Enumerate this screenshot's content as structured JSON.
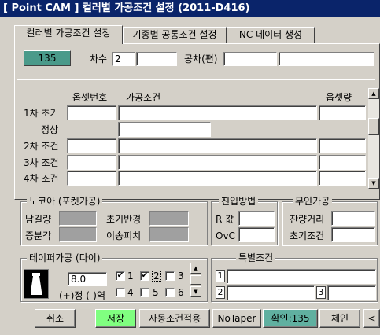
{
  "window": {
    "title": "[ Point CAM ]  컬러별 가공조건 설정  (2011-D416)"
  },
  "tabs": [
    {
      "label": "컬러별 가공조건 설정"
    },
    {
      "label": "기종별 공통조건 설정"
    },
    {
      "label": "NC 데이터 생성"
    }
  ],
  "header": {
    "color_number": "135",
    "order_label": "차수",
    "order_value": "2",
    "tolerance_label": "공차(편)"
  },
  "offset_table": {
    "columns": [
      "옵셋번호",
      "가공조건",
      "옵셋량"
    ],
    "rows": [
      {
        "label": "1차 초기"
      },
      {
        "label": "정상"
      },
      {
        "label": "2차 조건"
      },
      {
        "label": "3차 조건"
      },
      {
        "label": "4차 조건"
      }
    ]
  },
  "nozzle": {
    "title": "노코아 (포켓가공)",
    "remain_label": "남길량",
    "init_radius_label": "초기반경",
    "increment_label": "증분각",
    "move_pitch_label": "이송피치"
  },
  "approach": {
    "title": "진입방법",
    "r_label": "R 값",
    "ovc_label": "OvC"
  },
  "unmanned": {
    "title": "무인가공",
    "remain_dist_label": "잔량거리",
    "init_cond_label": "초기조건"
  },
  "taper": {
    "title": "테이퍼가공 (다이)",
    "value": "8.0",
    "direction_label": "(+)정 (-)역",
    "checks": [
      {
        "label": "1",
        "checked": true
      },
      {
        "label": "2",
        "checked": true
      },
      {
        "label": "3",
        "checked": false
      },
      {
        "label": "4",
        "checked": false
      },
      {
        "label": "5",
        "checked": false
      },
      {
        "label": "6",
        "checked": false
      }
    ]
  },
  "special": {
    "title": "특별조건",
    "row_labels": [
      "1",
      "2",
      "3"
    ]
  },
  "buttons": {
    "cancel": "취소",
    "save": "저장",
    "auto_apply": "자동조건적용",
    "notaper": "NoTaper",
    "confirm": "확인:135",
    "next": "체인",
    "arrow": "<"
  },
  "colors": {
    "badge": "#4a9a8a",
    "save_button": "#80ff80",
    "confirm_button": "#60b0a0",
    "titlebar": "#0a246a"
  }
}
